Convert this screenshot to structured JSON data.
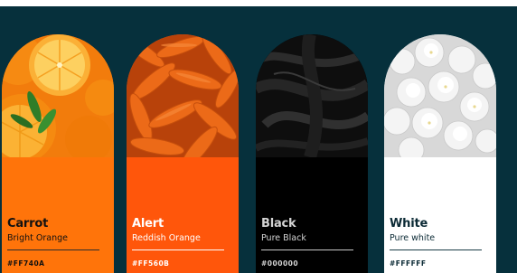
{
  "swatches": [
    {
      "name": "Carrot",
      "subtitle": "Bright Orange",
      "hex": "#FF740A",
      "card_color": "#ff740a",
      "text_color": "#111111",
      "rule_color": "#2c2c2c",
      "photo": "oranges"
    },
    {
      "name": "Alert",
      "subtitle": "Reddish Orange",
      "hex": "#FF560B",
      "card_color": "#ff560b",
      "text_color": "#ffffff",
      "rule_color": "#ffffff",
      "photo": "carrots"
    },
    {
      "name": "Black",
      "subtitle": "Pure Black",
      "hex": "#000000",
      "card_color": "#000000",
      "text_color": "#d4d4d4",
      "rule_color": "#c8c8c8",
      "photo": "black-silk"
    },
    {
      "name": "White",
      "subtitle": "Pure white",
      "hex": "#FFFFFF",
      "card_color": "#ffffff",
      "text_color": "#0b2a35",
      "rule_color": "#1b3c47",
      "photo": "white-flowers"
    }
  ],
  "background_color": "#06303c"
}
